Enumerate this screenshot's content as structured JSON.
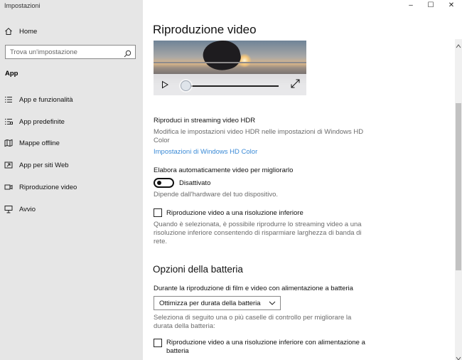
{
  "window": {
    "title": "Impostazioni",
    "minimize": "–",
    "maximize": "☐",
    "close": "✕"
  },
  "sidebar": {
    "home": "Home",
    "search_placeholder": "Trova un'impostazione",
    "section": "App",
    "items": [
      {
        "label": "App e funzionalità",
        "icon": "apps-list-icon"
      },
      {
        "label": "App predefinite",
        "icon": "default-apps-icon"
      },
      {
        "label": "Mappe offline",
        "icon": "map-icon"
      },
      {
        "label": "App per siti Web",
        "icon": "web-app-icon"
      },
      {
        "label": "Riproduzione video",
        "icon": "video-icon"
      },
      {
        "label": "Avvio",
        "icon": "startup-icon"
      }
    ]
  },
  "main": {
    "title": "Riproduzione video",
    "video": {
      "progress": 0.0
    },
    "hdr": {
      "heading": "Riproduci in streaming video HDR",
      "desc_line1": "Modifica le impostazioni video HDR nelle impostazioni di Windows HD",
      "desc_line2": "Color",
      "link": "Impostazioni di Windows HD Color"
    },
    "auto": {
      "heading": "Elabora automaticamente video per migliorarlo",
      "toggle_state": "Disattivato",
      "toggle_on": false,
      "desc": "Dipende dall'hardware del tuo dispositivo."
    },
    "lowres": {
      "label": "Riproduzione video a una risoluzione inferiore",
      "checked": false,
      "desc_line1": "Quando è selezionata, è possibile riprodurre lo streaming video a una",
      "desc_line2": "risoluzione inferiore consentendo di risparmiare larghezza di banda di",
      "desc_line3": "rete."
    },
    "battery": {
      "heading": "Opzioni della batteria",
      "label": "Durante la riproduzione di film e video con alimentazione a batteria",
      "dropdown_value": "Ottimizza per durata della batteria",
      "desc_line1": "Seleziona di seguito una o più caselle di controllo per migliorare la",
      "desc_line2": "durata della batteria:",
      "cb_line1": "Riproduzione video a una risoluzione inferiore con alimentazione a",
      "cb_line2": "batteria",
      "cb_checked": false
    }
  },
  "colors": {
    "link": "#3a8ad6",
    "sidebar_bg": "#e6e6e6"
  }
}
